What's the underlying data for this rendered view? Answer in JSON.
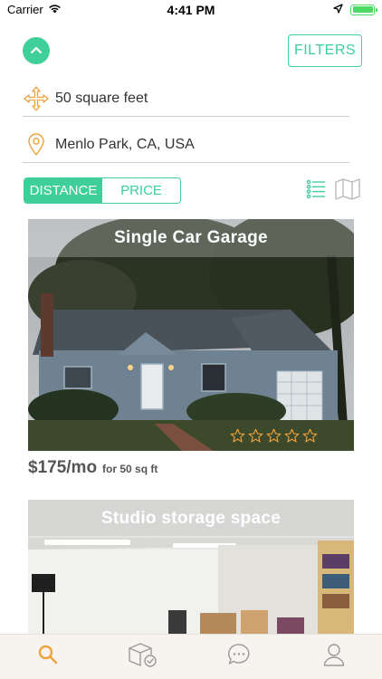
{
  "status_bar": {
    "carrier": "Carrier",
    "time": "4:41 PM"
  },
  "filters_button": "FILTERS",
  "search": {
    "size_value": "50 square feet",
    "location_value": "Menlo Park, CA, USA"
  },
  "sort": {
    "options": [
      "DISTANCE",
      "PRICE"
    ],
    "selected": "DISTANCE"
  },
  "listings": [
    {
      "title": "Single Car Garage",
      "price": "$175/mo",
      "size_note": "for 50 sq ft",
      "rating": 0,
      "rating_max": 5
    },
    {
      "title": "Studio storage space"
    }
  ],
  "tabs": [
    "search-icon",
    "box-check-icon",
    "chat-icon",
    "profile-icon"
  ],
  "colors": {
    "accent": "#3ecf9a",
    "icon_orange": "#f0a23c",
    "active_tab": "#f0a23c"
  }
}
